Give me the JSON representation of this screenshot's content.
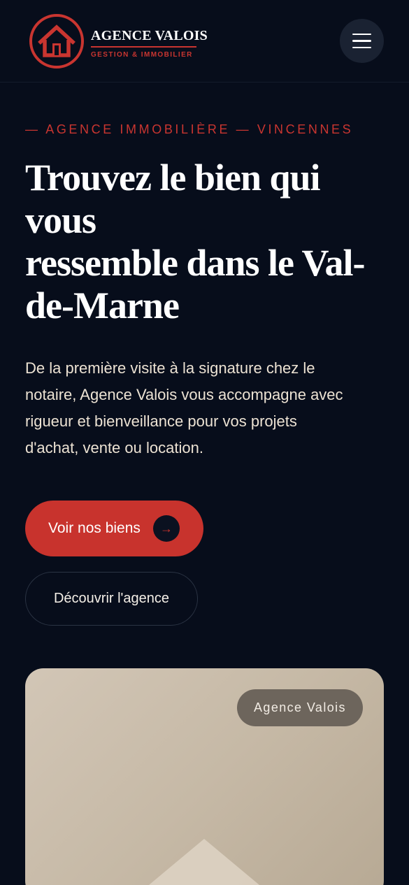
{
  "header": {
    "brand_name": "AGENCE VALOIS",
    "brand_tagline": "GESTION & IMMOBILIER",
    "logo_icon": "house-icon",
    "menu_icon": "hamburger-menu-icon"
  },
  "hero": {
    "eyebrow": "— AGENCE IMMOBILIÈRE — VINCENNES",
    "headline_lines": [
      "Trouvez le bien qui",
      "vous",
      "ressemble dans le Val-",
      "de-Marne"
    ],
    "lead_lines": [
      "De la première visite à la signature chez le",
      "notaire, Agence Valois vous accompagne avec",
      "rigueur et bienveillance pour vos projets",
      "d'achat, vente ou location."
    ],
    "primary_button": {
      "label": "Voir nos biens",
      "icon": "arrow-right-icon",
      "arrow_glyph": "→"
    },
    "secondary_button": {
      "label": "Découvrir l'agence"
    }
  },
  "card": {
    "badge": "Agence Valois",
    "illustration": "house-roof-icon"
  },
  "colors": {
    "background": "#070d1b",
    "accent": "#c8332d",
    "card": "#c9bca9"
  }
}
